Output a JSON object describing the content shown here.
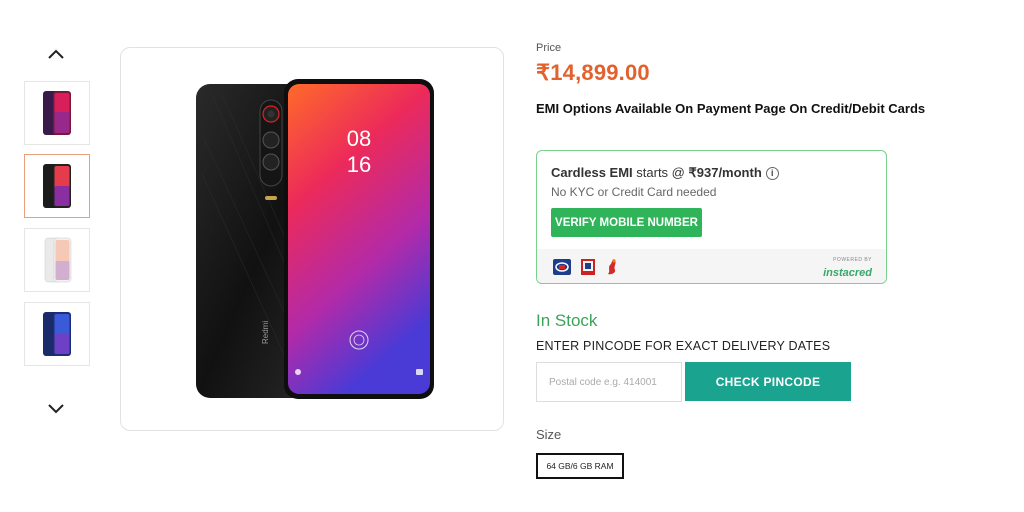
{
  "gallery": {
    "up_icon": "chevron-up-icon",
    "down_icon": "chevron-down-icon",
    "thumbnails": [
      {
        "variant": "red-front"
      },
      {
        "variant": "black-pair"
      },
      {
        "variant": "white-pair"
      },
      {
        "variant": "blue-pair"
      }
    ],
    "active_index": 1
  },
  "product": {
    "price_label": "Price",
    "price": "₹14,899.00",
    "emi_note": "EMI Options Available On Payment Page On Credit/Debit Cards",
    "clock_hour": "08",
    "clock_min": "16",
    "brand_on_phone": "Redmi"
  },
  "cardless_emi": {
    "title_bold": "Cardless EMI",
    "title_mid": " starts @ ",
    "title_amount": "₹937/month",
    "subtitle": "No KYC or Credit Card needed",
    "verify_button": "VERIFY MOBILE NUMBER",
    "powered_by": "POWERED BY",
    "partner": "instacred",
    "accent_color": "#2fb45a"
  },
  "delivery": {
    "stock_status": "In Stock",
    "pincode_label": "ENTER PINCODE FOR EXACT DELIVERY DATES",
    "pincode_placeholder": "Postal code e.g. 414001",
    "check_button": "CHECK PINCODE",
    "button_color": "#1aa38f"
  },
  "variants": {
    "size_label": "Size",
    "options": [
      "64 GB/6 GB RAM"
    ],
    "selected": "64 GB/6 GB RAM"
  }
}
